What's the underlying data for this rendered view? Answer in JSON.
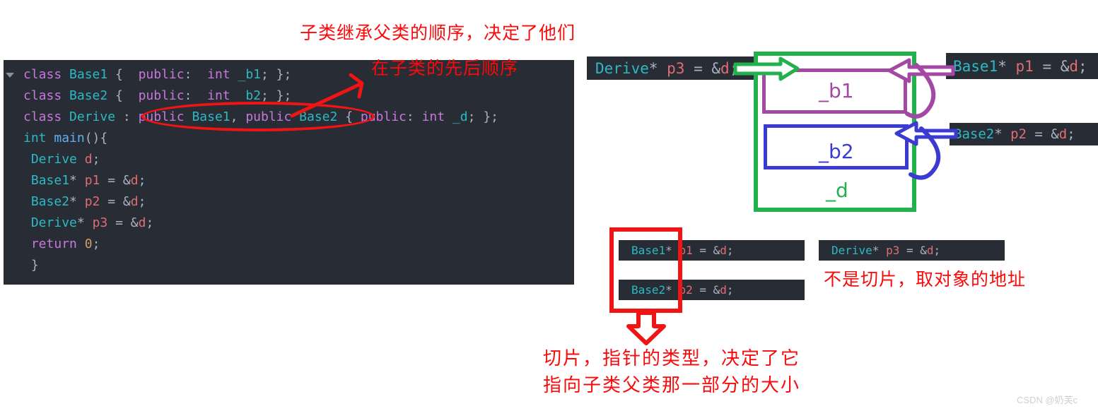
{
  "code_panel": {
    "lines": [
      [
        {
          "t": "class ",
          "c": "kw"
        },
        {
          "t": "Base1",
          "c": "typ"
        },
        {
          "t": " {  ",
          "c": "pun"
        },
        {
          "t": "public",
          "c": "kw"
        },
        {
          "t": ":  ",
          "c": "pun"
        },
        {
          "t": "int",
          "c": "kw"
        },
        {
          "t": " ",
          "c": "pun"
        },
        {
          "t": "_b1",
          "c": "typ"
        },
        {
          "t": "; };",
          "c": "pun"
        }
      ],
      [
        {
          "t": "class ",
          "c": "kw"
        },
        {
          "t": "Base2",
          "c": "typ"
        },
        {
          "t": " {  ",
          "c": "pun"
        },
        {
          "t": "public",
          "c": "kw"
        },
        {
          "t": ":  ",
          "c": "pun"
        },
        {
          "t": "int",
          "c": "kw"
        },
        {
          "t": " ",
          "c": "pun"
        },
        {
          "t": "_b2",
          "c": "typ"
        },
        {
          "t": "; };",
          "c": "pun"
        }
      ],
      [
        {
          "t": "class ",
          "c": "kw"
        },
        {
          "t": "Derive",
          "c": "typ"
        },
        {
          "t": " : ",
          "c": "pun"
        },
        {
          "t": "public ",
          "c": "kw"
        },
        {
          "t": "Base1",
          "c": "typ"
        },
        {
          "t": ", ",
          "c": "pun"
        },
        {
          "t": "public ",
          "c": "kw"
        },
        {
          "t": "Base2",
          "c": "typ"
        },
        {
          "t": " { ",
          "c": "pun"
        },
        {
          "t": "public",
          "c": "kw"
        },
        {
          "t": ": ",
          "c": "pun"
        },
        {
          "t": "int",
          "c": "kw"
        },
        {
          "t": " ",
          "c": "pun"
        },
        {
          "t": "_d",
          "c": "typ"
        },
        {
          "t": "; };",
          "c": "pun"
        }
      ],
      [
        {
          "t": "int ",
          "c": "typ"
        },
        {
          "t": "main",
          "c": "fn"
        },
        {
          "t": "(){",
          "c": "pun"
        }
      ],
      [
        {
          "t": " ",
          "c": "pun"
        },
        {
          "t": "Derive",
          "c": "typ"
        },
        {
          "t": " ",
          "c": "pun"
        },
        {
          "t": "d",
          "c": "var"
        },
        {
          "t": ";",
          "c": "pun"
        }
      ],
      [
        {
          "t": " ",
          "c": "pun"
        },
        {
          "t": "Base1",
          "c": "typ"
        },
        {
          "t": "* ",
          "c": "pun"
        },
        {
          "t": "p1",
          "c": "var"
        },
        {
          "t": " = &",
          "c": "pun"
        },
        {
          "t": "d",
          "c": "var"
        },
        {
          "t": ";",
          "c": "pun"
        }
      ],
      [
        {
          "t": " ",
          "c": "pun"
        },
        {
          "t": "Base2",
          "c": "typ"
        },
        {
          "t": "* ",
          "c": "pun"
        },
        {
          "t": "p2",
          "c": "var"
        },
        {
          "t": " = &",
          "c": "pun"
        },
        {
          "t": "d",
          "c": "var"
        },
        {
          "t": ";",
          "c": "pun"
        }
      ],
      [
        {
          "t": " ",
          "c": "pun"
        },
        {
          "t": "Derive",
          "c": "typ"
        },
        {
          "t": "* ",
          "c": "pun"
        },
        {
          "t": "p3",
          "c": "var"
        },
        {
          "t": " = &",
          "c": "pun"
        },
        {
          "t": "d",
          "c": "var"
        },
        {
          "t": ";",
          "c": "pun"
        }
      ],
      [
        {
          "t": " ",
          "c": "pun"
        },
        {
          "t": "return",
          "c": "kw"
        },
        {
          "t": " ",
          "c": "pun"
        },
        {
          "t": "0",
          "c": "num"
        },
        {
          "t": ";",
          "c": "pun"
        }
      ],
      [
        {
          "t": " }",
          "c": "pun"
        }
      ]
    ]
  },
  "chips": {
    "p3_top": [
      {
        "t": "Derive",
        "c": "typ"
      },
      {
        "t": "* ",
        "c": "pun"
      },
      {
        "t": "p3",
        "c": "var"
      },
      {
        "t": " = &",
        "c": "pun"
      },
      {
        "t": "d",
        "c": "var"
      },
      {
        "t": ";",
        "c": "pun"
      }
    ],
    "p1_right": [
      {
        "t": "Base1",
        "c": "typ"
      },
      {
        "t": "* ",
        "c": "pun"
      },
      {
        "t": "p1",
        "c": "var"
      },
      {
        "t": " = &",
        "c": "pun"
      },
      {
        "t": "d",
        "c": "var"
      },
      {
        "t": ";",
        "c": "pun"
      }
    ],
    "p2_right": [
      {
        "t": "Base2",
        "c": "typ"
      },
      {
        "t": "* ",
        "c": "pun"
      },
      {
        "t": "p2",
        "c": "var"
      },
      {
        "t": " = &",
        "c": "pun"
      },
      {
        "t": "d",
        "c": "var"
      },
      {
        "t": ";",
        "c": "pun"
      }
    ],
    "p1_bottom": [
      {
        "t": "Base1",
        "c": "typ"
      },
      {
        "t": "* ",
        "c": "pun"
      },
      {
        "t": "p1",
        "c": "var"
      },
      {
        "t": " = &",
        "c": "pun"
      },
      {
        "t": "d",
        "c": "var"
      },
      {
        "t": ";",
        "c": "pun"
      }
    ],
    "p2_bottom": [
      {
        "t": "Base2",
        "c": "typ"
      },
      {
        "t": "* ",
        "c": "pun"
      },
      {
        "t": "p2",
        "c": "var"
      },
      {
        "t": " = &",
        "c": "pun"
      },
      {
        "t": "d",
        "c": "var"
      },
      {
        "t": ";",
        "c": "pun"
      }
    ],
    "p3_bottom": [
      {
        "t": "Derive",
        "c": "typ"
      },
      {
        "t": "* ",
        "c": "pun"
      },
      {
        "t": "p3",
        "c": "var"
      },
      {
        "t": " = &",
        "c": "pun"
      },
      {
        "t": "d",
        "c": "var"
      },
      {
        "t": ";",
        "c": "pun"
      }
    ]
  },
  "annotations": {
    "top_line1": "子类继承父类的顺序，决定了他们",
    "top_line2": "在子类的先后顺序",
    "right_note": "不是切片，取对象的地址",
    "bottom_line1": "切片，指针的类型，决定了它",
    "bottom_line2": "指向子类父类那一部分的大小"
  },
  "memory_layout": {
    "b1_label": "_b1",
    "b2_label": "_b2",
    "d_label": "_d"
  },
  "colors": {
    "editor_bg": "#282c34",
    "annotation_red": "#fa0a0a",
    "green": "#22b14c",
    "purple": "#a349a4",
    "blue": "#3b3bd4",
    "type_cyan": "#2bbac5",
    "keyword_purple": "#c678dd",
    "var_red": "#e06c75"
  },
  "watermark": "CSDN @奶芙c"
}
